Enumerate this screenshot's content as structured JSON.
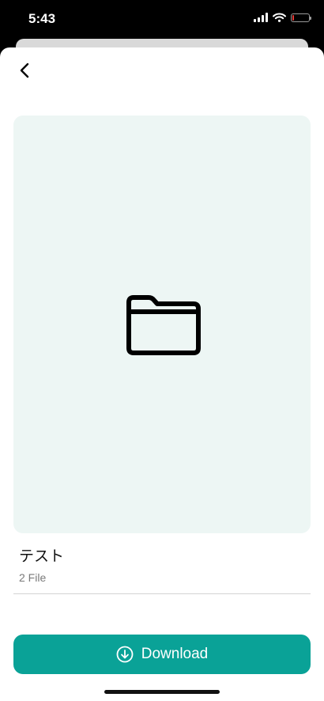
{
  "status_bar": {
    "time": "5:43",
    "icons": [
      "signal-icon",
      "wifi-icon",
      "battery-icon"
    ],
    "battery_level": 0.1
  },
  "header": {
    "back_icon": "chevron-left-icon"
  },
  "preview": {
    "icon": "folder-icon",
    "background_color": "#edf6f4"
  },
  "item": {
    "title": "テスト",
    "file_count": "2 File"
  },
  "actions": {
    "download_label": "Download",
    "download_icon": "download-circle-icon",
    "accent_color": "#0aa297"
  }
}
